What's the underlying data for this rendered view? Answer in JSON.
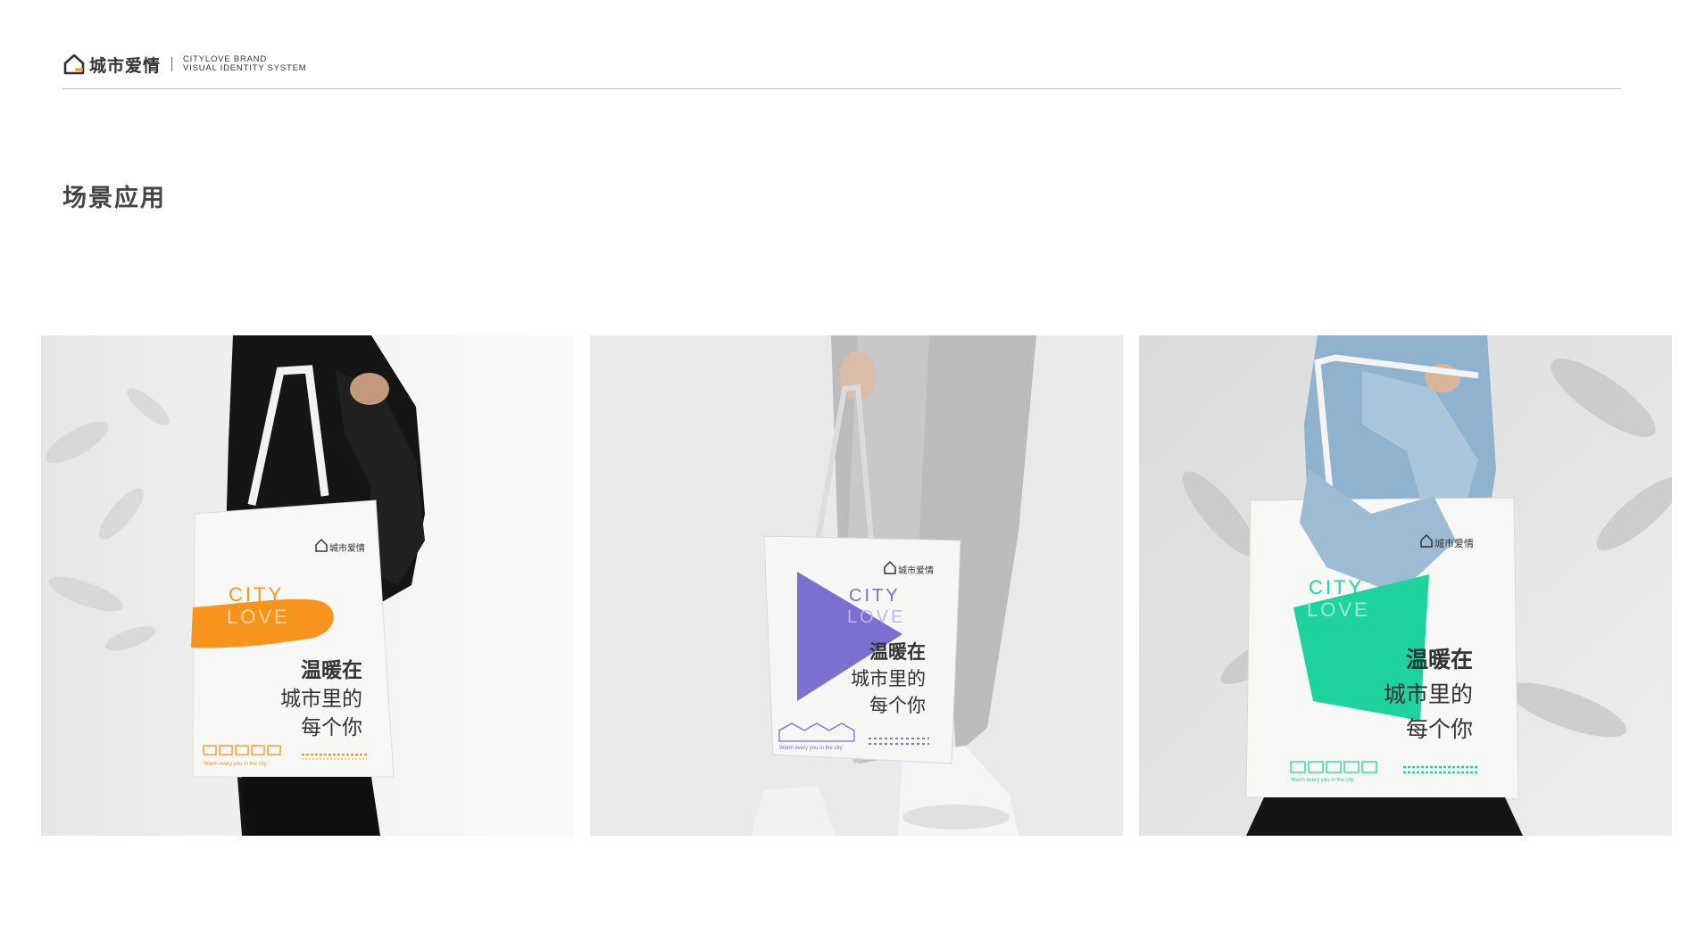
{
  "header": {
    "logo_text": "城市爱情",
    "brand_line1": "CITYLOVE BRAND",
    "brand_line2": "VISUAL IDENTITY SYSTEM"
  },
  "section": {
    "title": "场景应用"
  },
  "bag": {
    "logo_text": "城市爱情",
    "city": "CITY",
    "love": "LOVE",
    "slogan_line1": "温暖在",
    "slogan_line2": "城市里的",
    "slogan_line3": "每个你",
    "tagline": "Warm every you in the city."
  },
  "colors": {
    "orange": "#f7941d",
    "purple": "#7b6fd0",
    "green": "#1fd3a0",
    "text_dark": "#333333"
  },
  "photos": [
    {
      "variant": "orange",
      "scene": "man-black-shirt"
    },
    {
      "variant": "purple",
      "scene": "grey-pants-white-sneakers"
    },
    {
      "variant": "green",
      "scene": "denim-jacket-black-skirt"
    }
  ]
}
